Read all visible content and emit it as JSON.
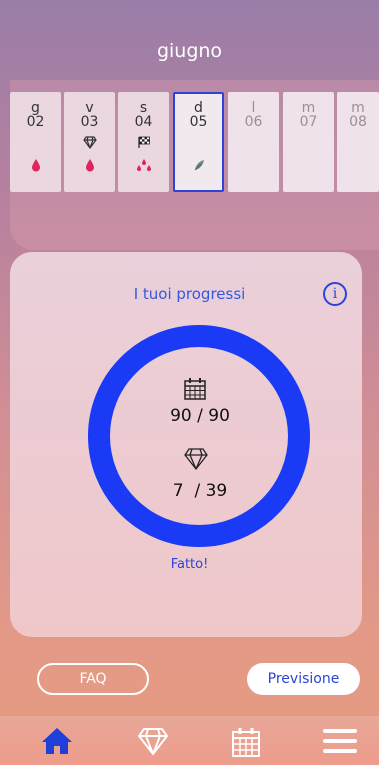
{
  "header": {
    "month": "giugno"
  },
  "calendar": {
    "days": [
      {
        "weekday": "g",
        "date": "02",
        "symbols": [
          "blood-drop-icon"
        ]
      },
      {
        "weekday": "v",
        "date": "03",
        "symbols": [
          "diamond-icon",
          "blood-drop-icon"
        ]
      },
      {
        "weekday": "s",
        "date": "04",
        "symbols": [
          "checkered-flag-icon",
          "spotting-drops-icon"
        ]
      },
      {
        "weekday": "d",
        "date": "05",
        "selected": true,
        "symbols": [
          "leaf-icon"
        ]
      },
      {
        "weekday": "l",
        "date": "06",
        "symbols": []
      },
      {
        "weekday": "m",
        "date": "07",
        "symbols": []
      },
      {
        "weekday": "m",
        "date": "08",
        "symbols": []
      }
    ]
  },
  "progress": {
    "title": "I tuoi progressi",
    "info_label": "i",
    "days_done": "90",
    "days_total": "/ 90",
    "gems_done": "7",
    "gems_total": "/ 39",
    "completion": 1.0,
    "status": "Fatto!"
  },
  "buttons": {
    "faq": "FAQ",
    "forecast": "Previsione"
  },
  "tabbar": {
    "items": [
      "home-icon",
      "diamond-icon",
      "calendar-icon",
      "menu-icon"
    ],
    "active": "home-icon"
  },
  "colors": {
    "accent": "#2b44d8",
    "ring": "#1a3af5",
    "blood": "#e0245e"
  }
}
